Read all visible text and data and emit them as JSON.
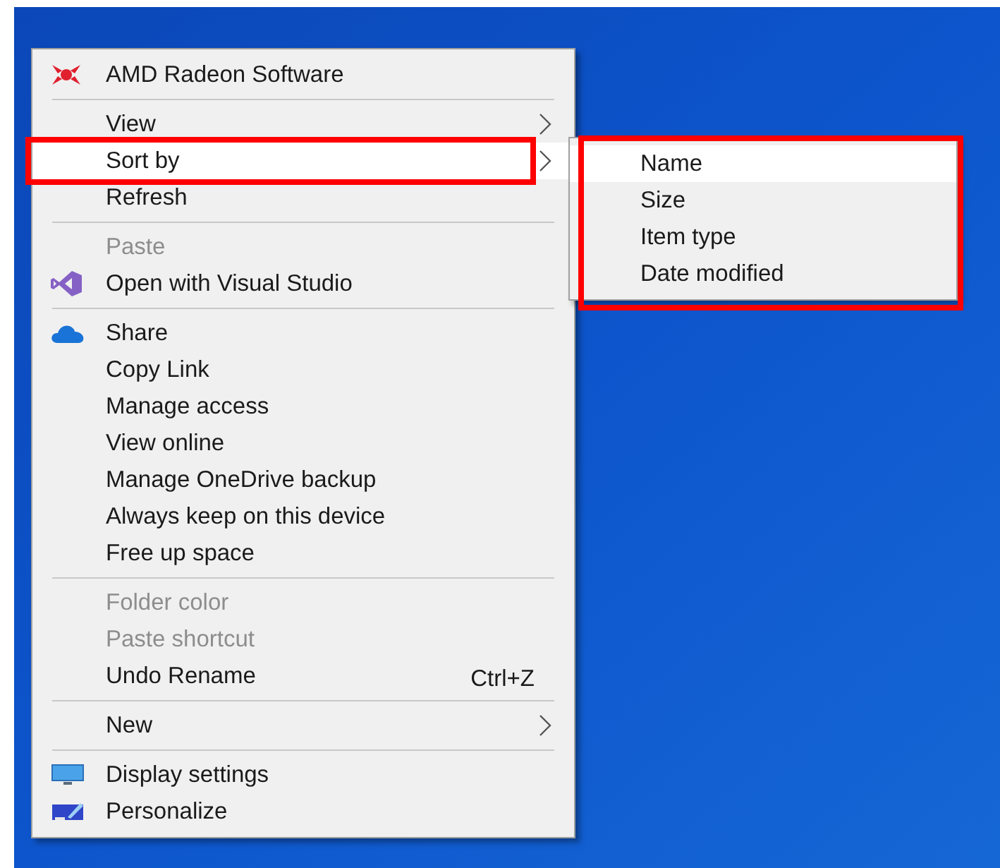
{
  "context_menu": {
    "items": [
      {
        "kind": "item",
        "label": "AMD Radeon Software",
        "disabled": false,
        "highlighted": false,
        "submenu": false,
        "annotated": false
      },
      {
        "kind": "separator"
      },
      {
        "kind": "item",
        "label": "View",
        "disabled": false,
        "highlighted": false,
        "submenu": true,
        "annotated": false
      },
      {
        "kind": "item",
        "label": "Sort by",
        "disabled": false,
        "highlighted": true,
        "submenu": true,
        "annotated": true
      },
      {
        "kind": "item",
        "label": "Refresh",
        "disabled": false,
        "highlighted": false,
        "submenu": false,
        "annotated": false
      },
      {
        "kind": "separator"
      },
      {
        "kind": "item",
        "label": "Paste",
        "disabled": true,
        "highlighted": false,
        "submenu": false,
        "annotated": false
      },
      {
        "kind": "item",
        "label": "Open with Visual Studio",
        "disabled": false,
        "highlighted": false,
        "submenu": false,
        "annotated": false
      },
      {
        "kind": "separator"
      },
      {
        "kind": "item",
        "label": "Share",
        "disabled": false,
        "highlighted": false,
        "submenu": false,
        "annotated": false
      },
      {
        "kind": "item",
        "label": "Copy Link",
        "disabled": false,
        "highlighted": false,
        "submenu": false,
        "annotated": false
      },
      {
        "kind": "item",
        "label": "Manage access",
        "disabled": false,
        "highlighted": false,
        "submenu": false,
        "annotated": false
      },
      {
        "kind": "item",
        "label": "View online",
        "disabled": false,
        "highlighted": false,
        "submenu": false,
        "annotated": false
      },
      {
        "kind": "item",
        "label": "Manage OneDrive backup",
        "disabled": false,
        "highlighted": false,
        "submenu": false,
        "annotated": false
      },
      {
        "kind": "item",
        "label": "Always keep on this device",
        "disabled": false,
        "highlighted": false,
        "submenu": false,
        "annotated": false
      },
      {
        "kind": "item",
        "label": "Free up space",
        "disabled": false,
        "highlighted": false,
        "submenu": false,
        "annotated": false
      },
      {
        "kind": "separator"
      },
      {
        "kind": "item",
        "label": "Folder color",
        "disabled": true,
        "highlighted": false,
        "submenu": false,
        "annotated": false
      },
      {
        "kind": "item",
        "label": "Paste shortcut",
        "disabled": true,
        "highlighted": false,
        "submenu": false,
        "annotated": false
      },
      {
        "kind": "item",
        "label": "Undo Rename",
        "shortcut": "Ctrl+Z",
        "disabled": false,
        "highlighted": false,
        "submenu": false,
        "annotated": false
      },
      {
        "kind": "separator"
      },
      {
        "kind": "item",
        "label": "New",
        "disabled": false,
        "highlighted": false,
        "submenu": true,
        "annotated": false
      },
      {
        "kind": "separator"
      },
      {
        "kind": "item",
        "label": "Display settings",
        "disabled": false,
        "highlighted": false,
        "submenu": false,
        "annotated": false
      },
      {
        "kind": "item",
        "label": "Personalize",
        "disabled": false,
        "highlighted": false,
        "submenu": false,
        "annotated": false
      }
    ]
  },
  "sort_submenu": {
    "annotated": true,
    "items": [
      {
        "label": "Name",
        "highlighted": true
      },
      {
        "label": "Size",
        "highlighted": false
      },
      {
        "label": "Item type",
        "highlighted": false
      },
      {
        "label": "Date modified",
        "highlighted": false
      }
    ]
  }
}
